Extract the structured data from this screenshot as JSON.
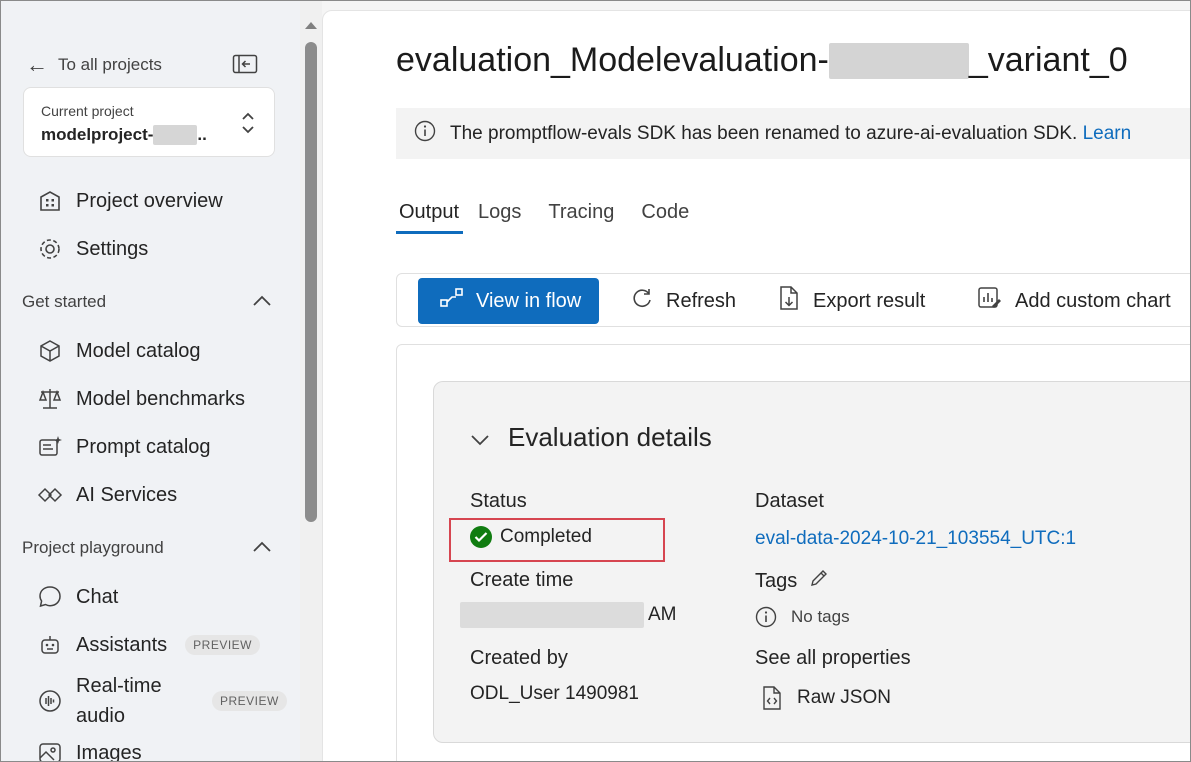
{
  "sidebar": {
    "back_label": "To all projects",
    "current_project_label": "Current project",
    "current_project_name": "modelproject-",
    "current_project_suffix": "..",
    "nav": [
      {
        "label": "Project overview",
        "icon": "building-icon"
      },
      {
        "label": "Settings",
        "icon": "gear-icon"
      }
    ],
    "sections": [
      {
        "title": "Get started",
        "items": [
          {
            "label": "Model catalog",
            "icon": "cube-icon"
          },
          {
            "label": "Model benchmarks",
            "icon": "scales-icon"
          },
          {
            "label": "Prompt catalog",
            "icon": "prompt-sparkle-icon"
          },
          {
            "label": "AI Services",
            "icon": "diamond-link-icon"
          }
        ]
      },
      {
        "title": "Project playground",
        "items": [
          {
            "label": "Chat",
            "icon": "chat-icon"
          },
          {
            "label": "Assistants",
            "icon": "bot-icon",
            "badge": "PREVIEW"
          },
          {
            "label": "Real-time audio",
            "label_line1": "Real-time",
            "label_line2": "audio",
            "icon": "audio-icon",
            "badge": "PREVIEW"
          },
          {
            "label": "Images",
            "icon": "image-icon"
          }
        ]
      }
    ]
  },
  "main": {
    "title_prefix": "evaluation_Modelevaluation-",
    "title_suffix": "_variant_0",
    "banner_text": "The promptflow-evals SDK has been renamed to azure-ai-evaluation SDK.",
    "banner_link": "Learn",
    "tabs": [
      {
        "label": "Output",
        "active": true
      },
      {
        "label": "Logs",
        "active": false
      },
      {
        "label": "Tracing",
        "active": false
      },
      {
        "label": "Code",
        "active": false
      }
    ],
    "toolbar": {
      "view_in_flow": "View in flow",
      "refresh": "Refresh",
      "export_result": "Export result",
      "add_custom_chart": "Add custom chart"
    },
    "details": {
      "heading": "Evaluation details",
      "status_label": "Status",
      "status_value": "Completed",
      "create_time_label": "Create time",
      "create_time_suffix": "AM",
      "created_by_label": "Created by",
      "created_by_value": "ODL_User 1490981",
      "dataset_label": "Dataset",
      "dataset_value": "eval-data-2024-10-21_103554_UTC:1",
      "tags_label": "Tags",
      "tags_value": "No tags",
      "see_all_label": "See all properties",
      "raw_json": "Raw JSON"
    }
  },
  "colors": {
    "accent": "#0f6cbd",
    "success": "#107c10",
    "highlight_box": "#d64550"
  }
}
